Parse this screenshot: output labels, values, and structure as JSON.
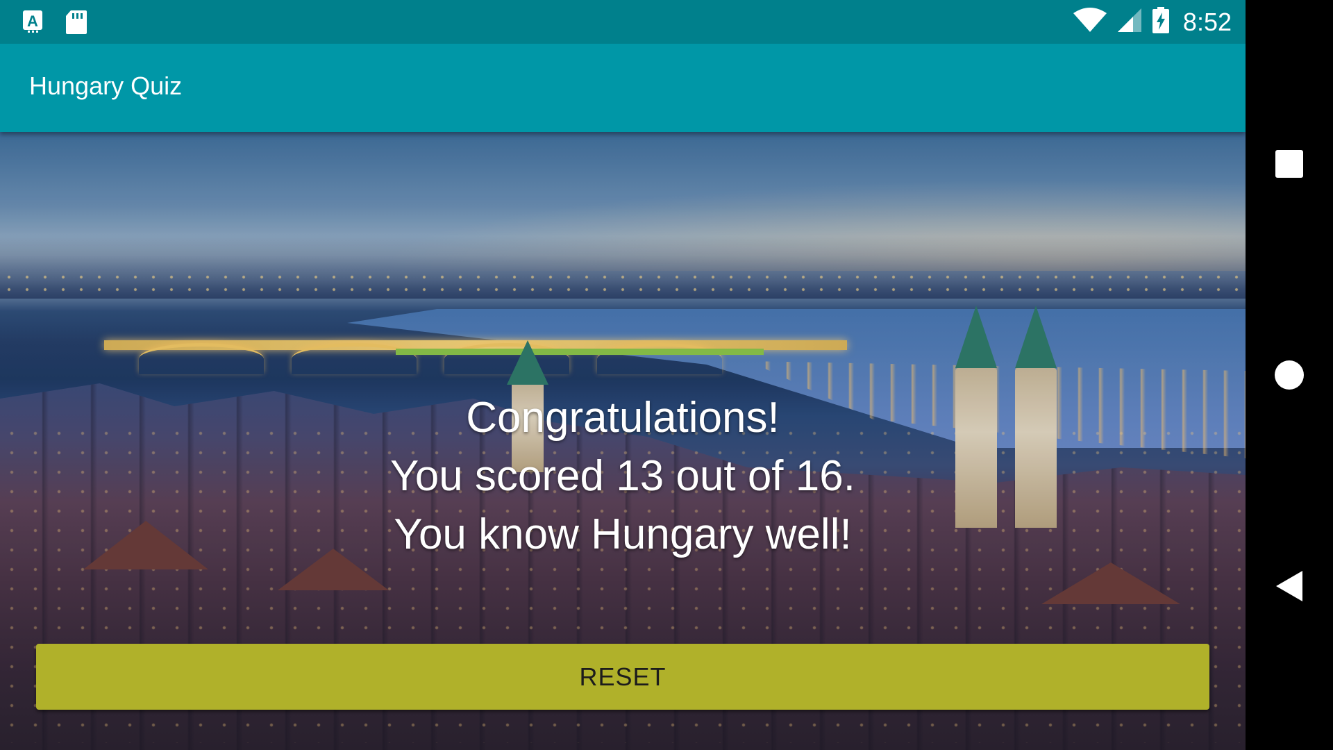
{
  "status_bar": {
    "left_icons": [
      "app-notification-icon",
      "sd-card-icon"
    ],
    "right_icons": [
      "wifi-icon",
      "cell-signal-icon",
      "battery-charging-icon"
    ],
    "clock": "8:52",
    "background_color": "#00808c"
  },
  "toolbar": {
    "title": "Hungary Quiz",
    "background_color": "#0097a7"
  },
  "result": {
    "line1": "Congratulations!",
    "line2": "You scored 13 out of 16.",
    "line3": "You know Hungary well!"
  },
  "reset_button": {
    "label": "RESET",
    "color": "#b0b12a"
  },
  "nav_bar": {
    "buttons": [
      "recents-icon",
      "home-icon",
      "back-icon"
    ]
  },
  "background": {
    "image": "budapest-city-skyline"
  },
  "accent_colors": {
    "progress_line": "#8bc34a"
  }
}
